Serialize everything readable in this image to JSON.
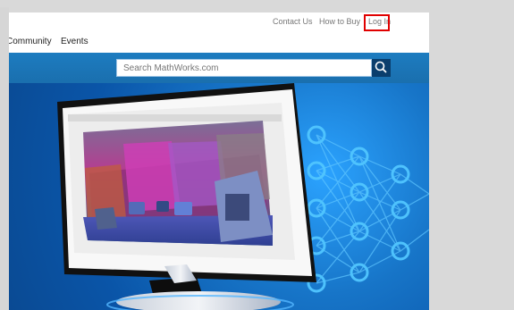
{
  "utility_nav": {
    "contact": "Contact Us",
    "how_to_buy": "How to Buy",
    "login": "Log In"
  },
  "main_nav": {
    "items": [
      "Community",
      "Events"
    ]
  },
  "search": {
    "placeholder": "Search MathWorks.com"
  },
  "icons": {
    "search": "search-icon"
  },
  "colors": {
    "brand_blue": "#1a6fae",
    "search_button": "#0a3e6d",
    "highlight": "#e00000"
  }
}
